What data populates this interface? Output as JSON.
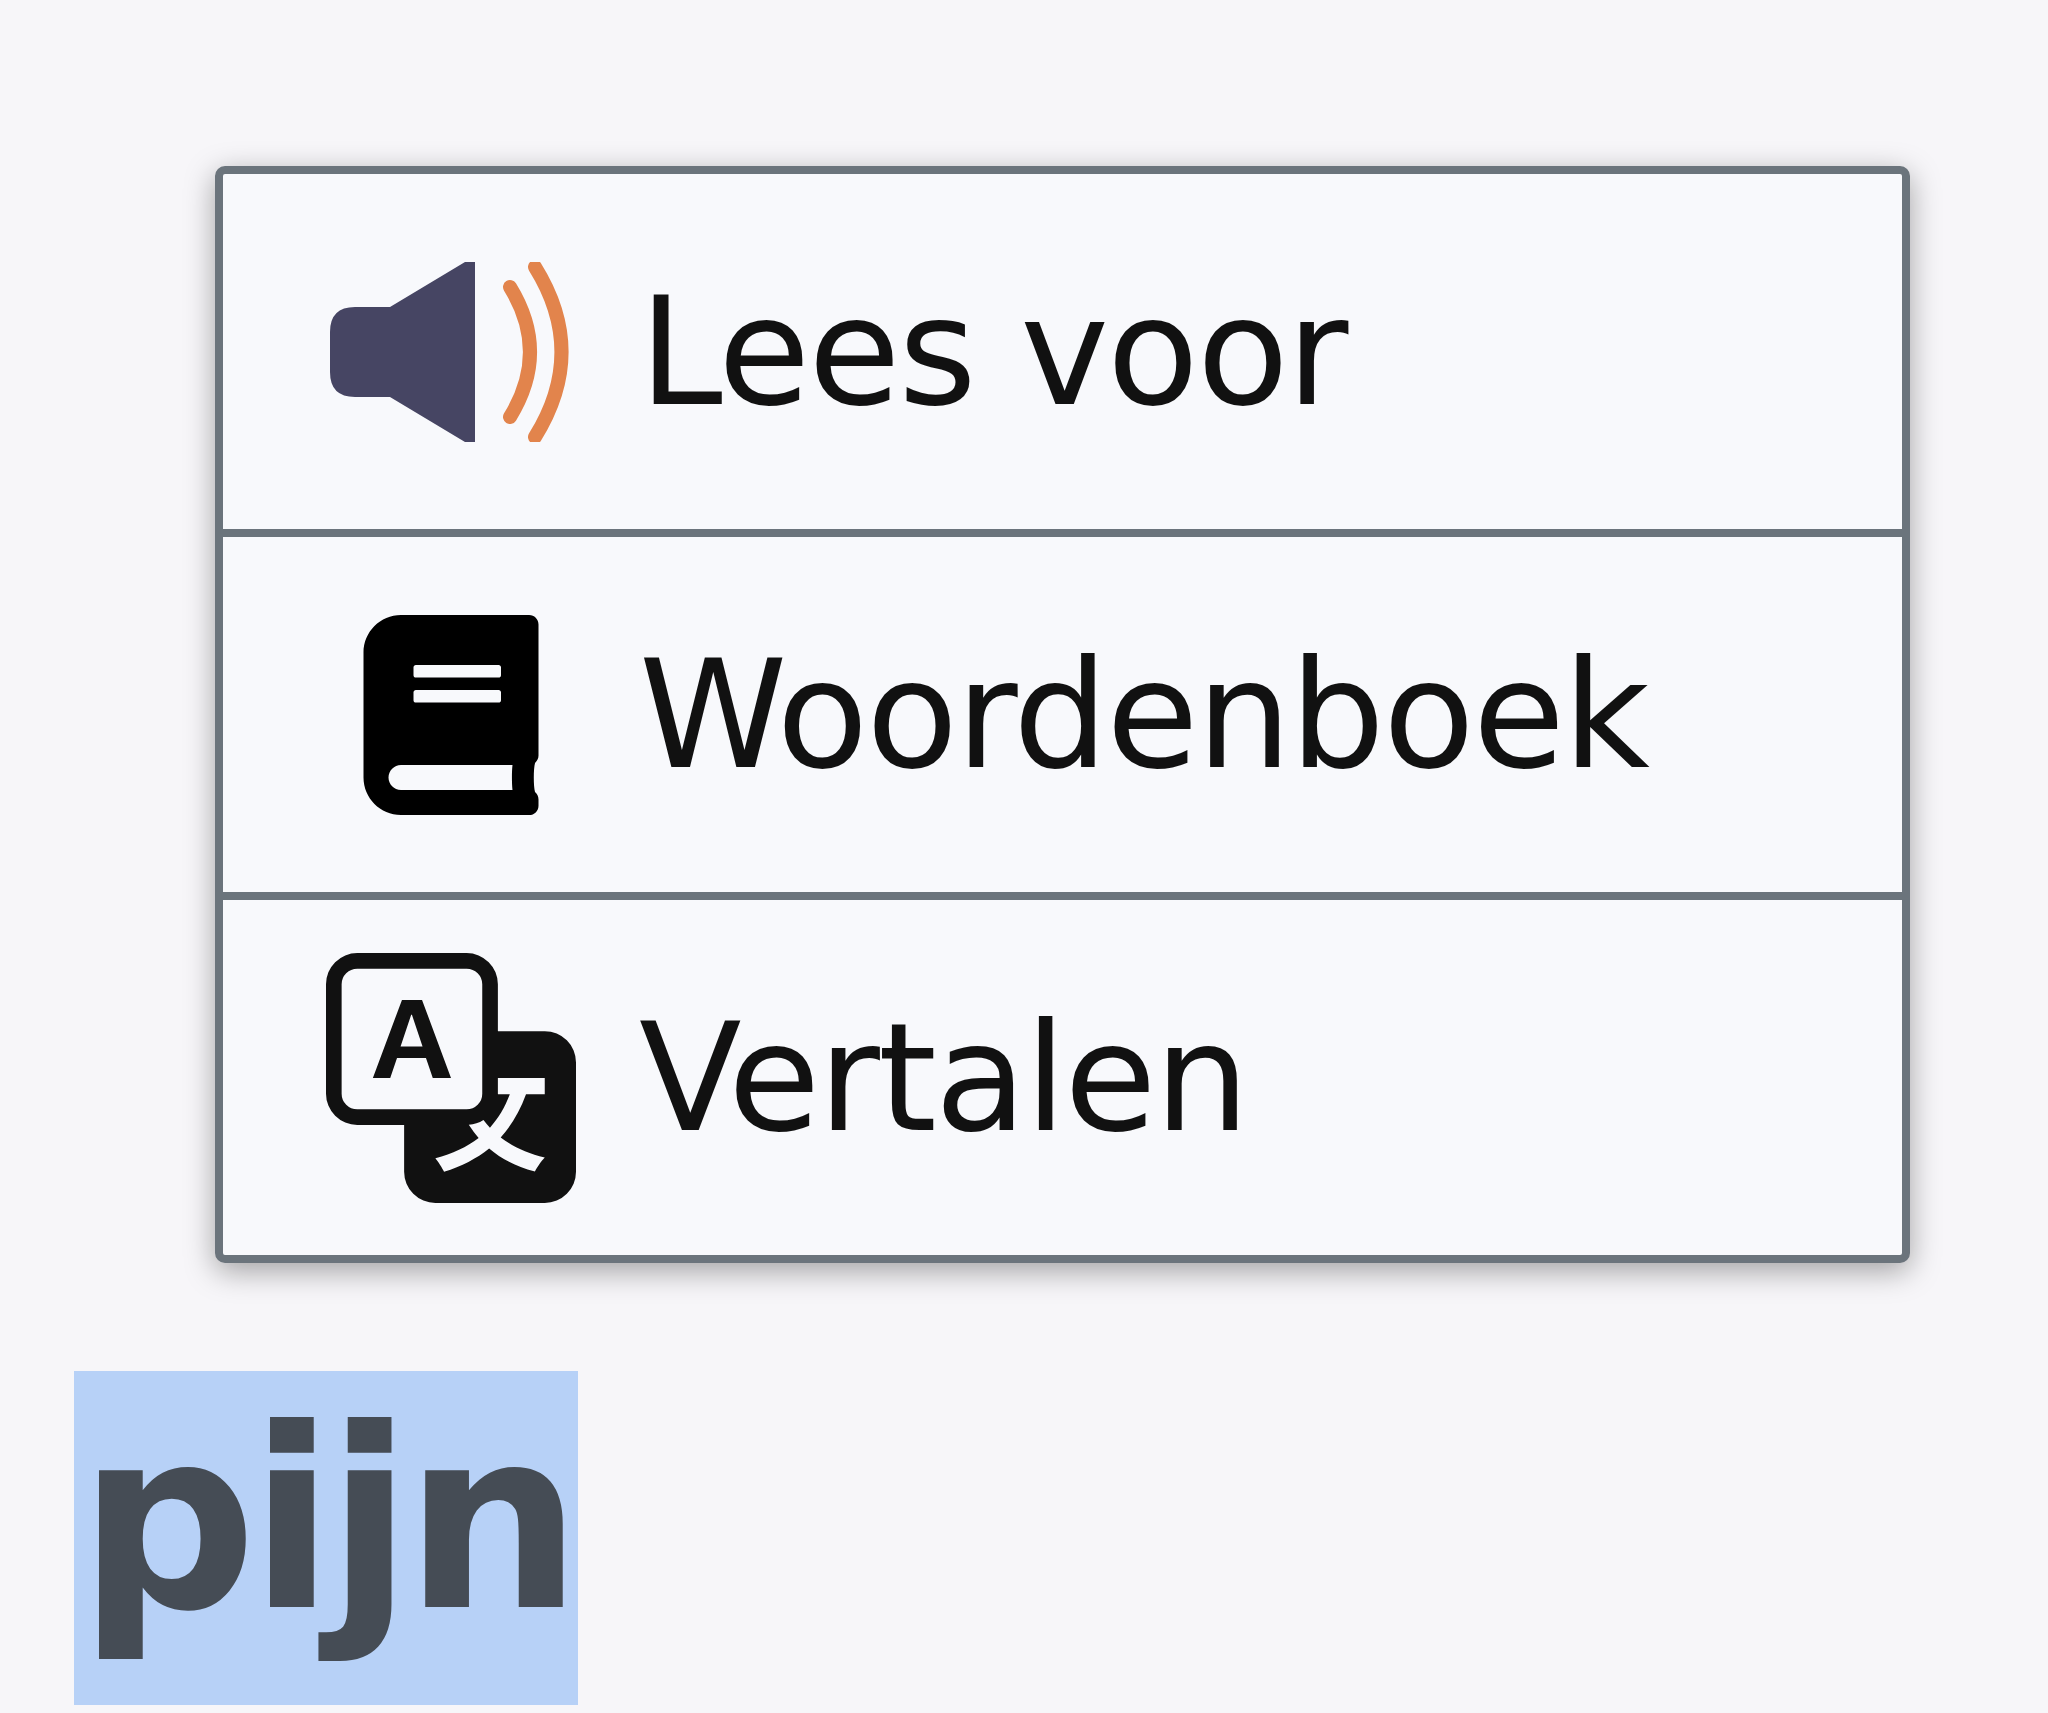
{
  "context_menu": {
    "items": [
      {
        "label": "Lees voor"
      },
      {
        "label": "Woordenboek"
      },
      {
        "label": "Vertalen"
      }
    ]
  },
  "selected_word": {
    "text": "pijn",
    "selected": true
  }
}
